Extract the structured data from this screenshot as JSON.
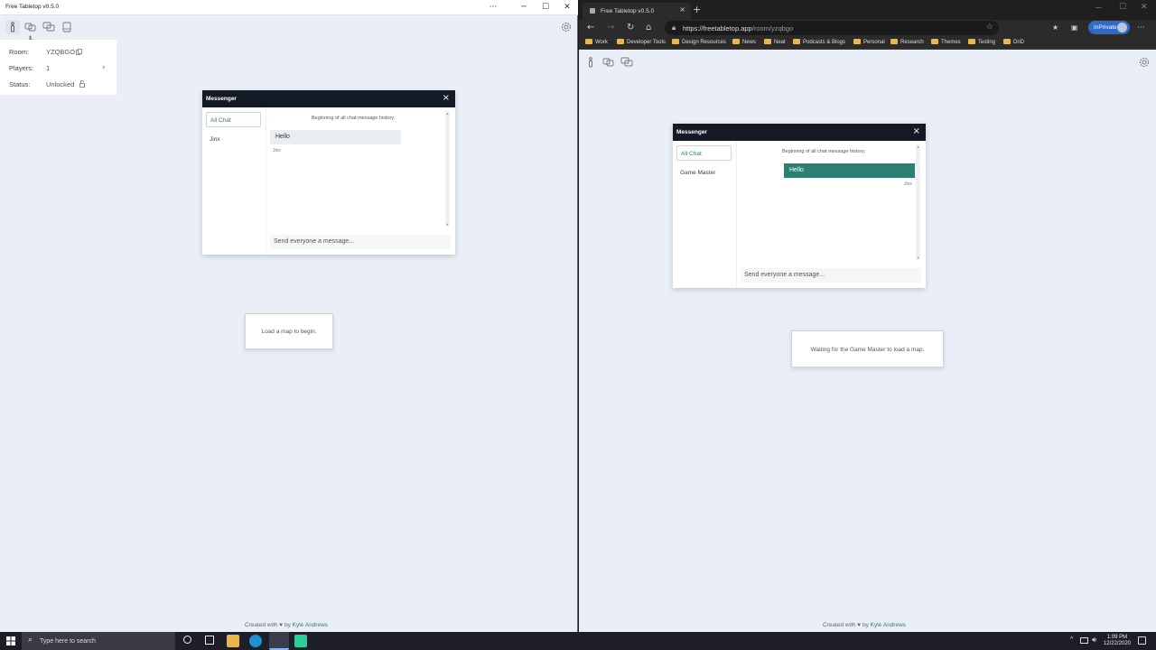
{
  "left_app": {
    "title": "Free Tabletop v0.5.0",
    "window_controls": {
      "more": "···",
      "minimize": "─",
      "maximize": "☐",
      "close": "✕"
    },
    "info": {
      "room_label": "Room:",
      "room_value": "YZQBGO",
      "players_label": "Players:",
      "players_value": "1",
      "status_label": "Status:",
      "status_value": "Unlocked"
    },
    "messenger": {
      "title": "Messenger",
      "tabs": [
        "All Chat",
        "Jinx"
      ],
      "history": "Beginning of all chat message history.",
      "message": "Hello",
      "sender": "Jinx",
      "input_placeholder": "Send everyone a message..."
    },
    "notice": "Load a map to begin.",
    "footer": {
      "prefix": "Created with ♥ by",
      "author": "Kyle Andrews"
    }
  },
  "browser": {
    "tab_title": "Free Tabletop v0.5.0",
    "url_host": "https://freetabletop.app",
    "url_path": "/room/yzqbgo",
    "profile": "InPrivate",
    "bookmarks": [
      "Work",
      "Developer Tools",
      "Design Resources",
      "News",
      "Neat",
      "Podcasts & Blogs",
      "Personal",
      "Research",
      "Themes",
      "Testing",
      "DnD"
    ]
  },
  "right_app": {
    "messenger": {
      "title": "Messenger",
      "tabs": [
        "All Chat",
        "Game Master"
      ],
      "history": "Beginning of all chat message history.",
      "message": "Hello",
      "sender": "Jinx",
      "input_placeholder": "Send everyone a message..."
    },
    "notice": "Waiting for the Game Master to load a map.",
    "footer": {
      "prefix": "Created with ♥ by",
      "author": "Kyle Andrews"
    }
  },
  "taskbar": {
    "search_placeholder": "Type here to search",
    "time": "1:09 PM",
    "date": "12/22/2020"
  },
  "colors": {
    "accent": "#2e7f73",
    "messenger_header": "#131a26",
    "app_bg": "#eaeff7",
    "inprivate": "#2f6ac7"
  }
}
